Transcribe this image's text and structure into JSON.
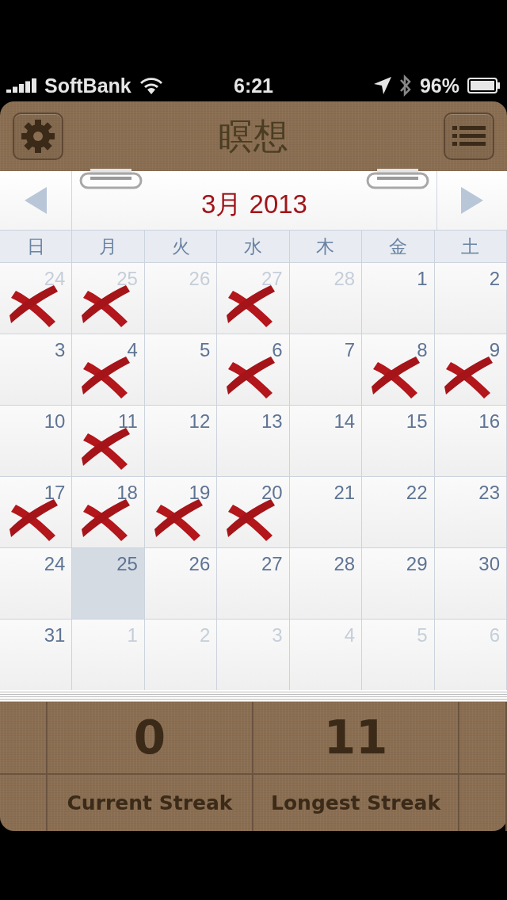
{
  "status_bar": {
    "carrier": "SoftBank",
    "time": "6:21",
    "battery": "96%"
  },
  "header": {
    "title": "瞑想"
  },
  "calendar": {
    "month": "3月 2013",
    "weekdays": [
      "日",
      "月",
      "火",
      "水",
      "木",
      "金",
      "土"
    ],
    "weeks": [
      {
        "days": [
          {
            "day": "24",
            "in_month": false,
            "marked": true,
            "selected": false
          },
          {
            "day": "25",
            "in_month": false,
            "marked": true,
            "selected": false
          },
          {
            "day": "26",
            "in_month": false,
            "marked": false,
            "selected": false
          },
          {
            "day": "27",
            "in_month": false,
            "marked": true,
            "selected": false
          },
          {
            "day": "28",
            "in_month": false,
            "marked": false,
            "selected": false
          },
          {
            "day": "1",
            "in_month": true,
            "marked": false,
            "selected": false
          },
          {
            "day": "2",
            "in_month": true,
            "marked": false,
            "selected": false
          }
        ]
      },
      {
        "days": [
          {
            "day": "3",
            "in_month": true,
            "marked": false,
            "selected": false
          },
          {
            "day": "4",
            "in_month": true,
            "marked": true,
            "selected": false
          },
          {
            "day": "5",
            "in_month": true,
            "marked": false,
            "selected": false
          },
          {
            "day": "6",
            "in_month": true,
            "marked": true,
            "selected": false
          },
          {
            "day": "7",
            "in_month": true,
            "marked": false,
            "selected": false
          },
          {
            "day": "8",
            "in_month": true,
            "marked": true,
            "selected": false
          },
          {
            "day": "9",
            "in_month": true,
            "marked": true,
            "selected": false
          }
        ]
      },
      {
        "days": [
          {
            "day": "10",
            "in_month": true,
            "marked": false,
            "selected": false
          },
          {
            "day": "11",
            "in_month": true,
            "marked": true,
            "selected": false
          },
          {
            "day": "12",
            "in_month": true,
            "marked": false,
            "selected": false
          },
          {
            "day": "13",
            "in_month": true,
            "marked": false,
            "selected": false
          },
          {
            "day": "14",
            "in_month": true,
            "marked": false,
            "selected": false
          },
          {
            "day": "15",
            "in_month": true,
            "marked": false,
            "selected": false
          },
          {
            "day": "16",
            "in_month": true,
            "marked": false,
            "selected": false
          }
        ]
      },
      {
        "days": [
          {
            "day": "17",
            "in_month": true,
            "marked": true,
            "selected": false
          },
          {
            "day": "18",
            "in_month": true,
            "marked": true,
            "selected": false
          },
          {
            "day": "19",
            "in_month": true,
            "marked": true,
            "selected": false
          },
          {
            "day": "20",
            "in_month": true,
            "marked": true,
            "selected": false
          },
          {
            "day": "21",
            "in_month": true,
            "marked": false,
            "selected": false
          },
          {
            "day": "22",
            "in_month": true,
            "marked": false,
            "selected": false
          },
          {
            "day": "23",
            "in_month": true,
            "marked": false,
            "selected": false
          }
        ]
      },
      {
        "days": [
          {
            "day": "24",
            "in_month": true,
            "marked": false,
            "selected": false
          },
          {
            "day": "25",
            "in_month": true,
            "marked": false,
            "selected": true
          },
          {
            "day": "26",
            "in_month": true,
            "marked": false,
            "selected": false
          },
          {
            "day": "27",
            "in_month": true,
            "marked": false,
            "selected": false
          },
          {
            "day": "28",
            "in_month": true,
            "marked": false,
            "selected": false
          },
          {
            "day": "29",
            "in_month": true,
            "marked": false,
            "selected": false
          },
          {
            "day": "30",
            "in_month": true,
            "marked": false,
            "selected": false
          }
        ]
      },
      {
        "days": [
          {
            "day": "31",
            "in_month": true,
            "marked": false,
            "selected": false
          },
          {
            "day": "1",
            "in_month": false,
            "marked": false,
            "selected": false
          },
          {
            "day": "2",
            "in_month": false,
            "marked": false,
            "selected": false
          },
          {
            "day": "3",
            "in_month": false,
            "marked": false,
            "selected": false
          },
          {
            "day": "4",
            "in_month": false,
            "marked": false,
            "selected": false
          },
          {
            "day": "5",
            "in_month": false,
            "marked": false,
            "selected": false
          },
          {
            "day": "6",
            "in_month": false,
            "marked": false,
            "selected": false
          }
        ]
      }
    ]
  },
  "stats": [
    {
      "value": "0",
      "label": "Current Streak"
    },
    {
      "value": "11",
      "label": "Longest Streak"
    }
  ]
}
